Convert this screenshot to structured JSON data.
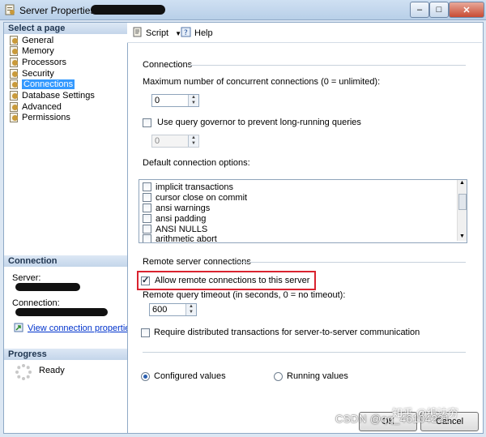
{
  "window": {
    "title": "Server Properties - ",
    "controls": {
      "minimize": "–",
      "maximize": "□",
      "close": "✕"
    }
  },
  "left": {
    "select_page_header": "Select a page",
    "pages": [
      "General",
      "Memory",
      "Processors",
      "Security",
      "Connections",
      "Database Settings",
      "Advanced",
      "Permissions"
    ],
    "selected": "Connections",
    "connection_header": "Connection",
    "server_label": "Server:",
    "connection_label": "Connection:",
    "view_link": "View connection properties",
    "progress_header": "Progress",
    "progress_status": "Ready"
  },
  "toolbar": {
    "script_label": "Script",
    "help_label": "Help"
  },
  "connections": {
    "group_label": "Connections",
    "max_concurrent_label": "Maximum number of concurrent connections (0 = unlimited):",
    "max_concurrent_value": "0",
    "query_governor_label": "Use query governor to prevent long-running queries",
    "query_governor_checked": false,
    "query_governor_value": "0",
    "default_options_label": "Default connection options:",
    "options": [
      {
        "label": "implicit transactions",
        "checked": false
      },
      {
        "label": "cursor close on commit",
        "checked": false
      },
      {
        "label": "ansi warnings",
        "checked": false
      },
      {
        "label": "ansi padding",
        "checked": false
      },
      {
        "label": "ANSI NULLS",
        "checked": false
      },
      {
        "label": "arithmetic abort",
        "checked": false
      }
    ]
  },
  "remote": {
    "group_label": "Remote server connections",
    "allow_remote_label": "Allow remote connections to this server",
    "allow_remote_checked": true,
    "timeout_label": "Remote query timeout (in seconds, 0 = no timeout):",
    "timeout_value": "600",
    "distributed_label": "Require distributed transactions for server-to-server communication",
    "distributed_checked": false
  },
  "values_mode": {
    "configured_label": "Configured values",
    "running_label": "Running values",
    "selected": "configured"
  },
  "buttons": {
    "ok": "OK",
    "cancel": "Cancel"
  },
  "watermark": {
    "line1": "知乎 @编法穷",
    "line2": "CSDN @qq_46104221"
  },
  "colors": {
    "highlight": "#d9232f",
    "selection": "#3399ff",
    "link": "#0033cc"
  }
}
